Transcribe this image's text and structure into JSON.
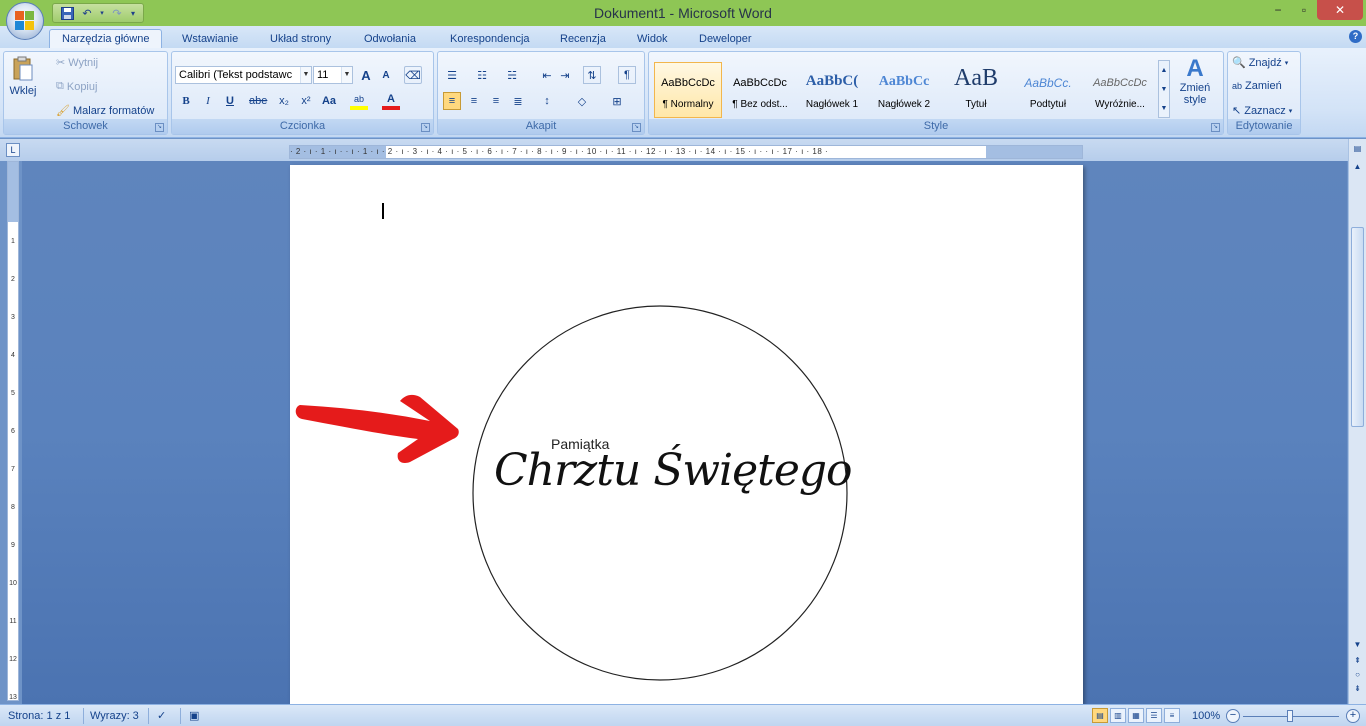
{
  "window": {
    "title": "Dokument1 - Microsoft Word",
    "minimize_icon": "minimize-icon",
    "maximize_icon": "maximize-icon",
    "close_icon": "close-icon"
  },
  "tabs": [
    {
      "label": "Narzędzia główne",
      "active": true
    },
    {
      "label": "Wstawianie"
    },
    {
      "label": "Układ strony"
    },
    {
      "label": "Odwołania"
    },
    {
      "label": "Korespondencja"
    },
    {
      "label": "Recenzja"
    },
    {
      "label": "Widok"
    },
    {
      "label": "Deweloper"
    }
  ],
  "clipboard": {
    "paste": "Wklej",
    "cut": "Wytnij",
    "copy": "Kopiuj",
    "format_painter": "Malarz formatów",
    "group_label": "Schowek"
  },
  "font": {
    "family": "Calibri (Tekst podstawc",
    "size": "11",
    "group_label": "Czcionka",
    "bold": "B",
    "italic": "I",
    "underline": "U",
    "strike": "abe",
    "subscript": "x₂",
    "superscript": "x²",
    "case": "Aa",
    "grow": "A",
    "shrink": "A",
    "color": "A"
  },
  "paragraph": {
    "group_label": "Akapit",
    "show_marks": "¶"
  },
  "styles": {
    "group_label": "Style",
    "items": [
      {
        "sample": "AaBbCcDc",
        "name": "¶ Normalny"
      },
      {
        "sample": "AaBbCcDc",
        "name": "¶ Bez odst..."
      },
      {
        "sample": "AaBbC(",
        "name": "Nagłówek 1"
      },
      {
        "sample": "AaBbCc",
        "name": "Nagłówek 2"
      },
      {
        "sample": "AaB",
        "name": "Tytuł"
      },
      {
        "sample": "AaBbCc.",
        "name": "Podtytuł"
      },
      {
        "sample": "AaBbCcDc",
        "name": "Wyróżnie..."
      }
    ],
    "change_styles": "Zmień",
    "change_styles_2": "style"
  },
  "editing": {
    "group_label": "Edytowanie",
    "find": "Znajdź",
    "replace": "Zamień",
    "select": "Zaznacz"
  },
  "ruler": {
    "text": "· 2 · ı · 1 · ı ·    · ı · 1 · ı · 2 · ı · 3 · ı · 4 · ı · 5 · ı · 6 · ı · 7 · ı · 8 · ı · 9 · ı · 10 · ı · 11 · ı · 12 · ı · 13 · ı · 14 · ı · 15 · ı ·   · ı · 17 · ı · 18 ·",
    "vertical": [
      "1",
      "2",
      "3",
      "4",
      "5",
      "6",
      "7",
      "8",
      "9",
      "10",
      "11",
      "12",
      "13"
    ]
  },
  "document": {
    "small_text": "Pamiątka",
    "script_text": "Chrztu Świętego"
  },
  "status": {
    "page": "Strona: 1 z 1",
    "words": "Wyrazy: 3",
    "zoom": "100%"
  },
  "colors": {
    "titlebar": "#8ec655",
    "arrow": "#e51b1b",
    "canvas": "#5a82bd"
  }
}
